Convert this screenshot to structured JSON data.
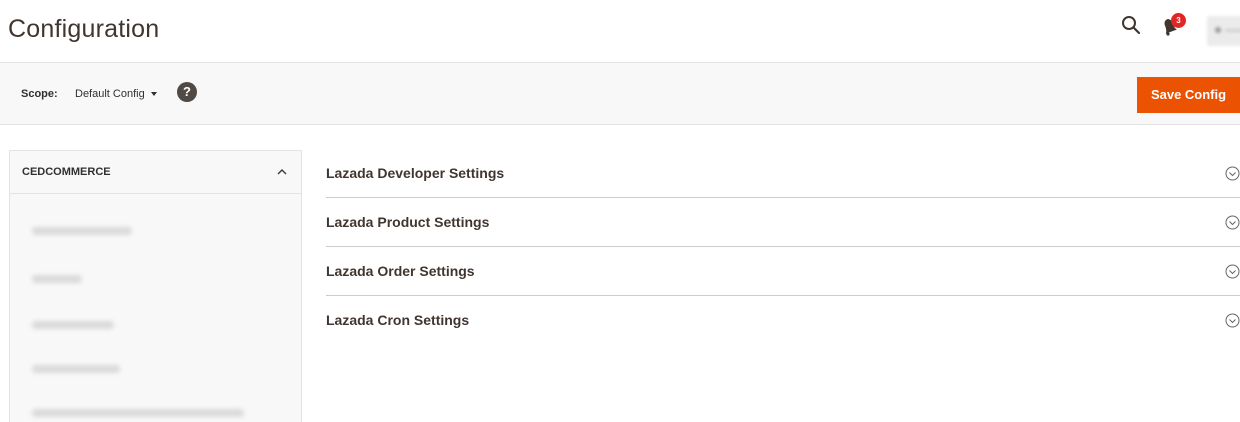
{
  "header": {
    "title": "Configuration",
    "notifications_count": "3"
  },
  "scope": {
    "label": "Scope:",
    "value": "Default Config",
    "help_icon": "?",
    "save_label": "Save Config"
  },
  "sidebar": {
    "title": "CEDCOMMERCE"
  },
  "sections": [
    {
      "title": "Lazada Developer Settings"
    },
    {
      "title": "Lazada Product Settings"
    },
    {
      "title": "Lazada Order Settings"
    },
    {
      "title": "Lazada Cron Settings"
    }
  ],
  "colors": {
    "accent": "#eb5202",
    "badge": "#e22626",
    "text": "#41362f"
  }
}
